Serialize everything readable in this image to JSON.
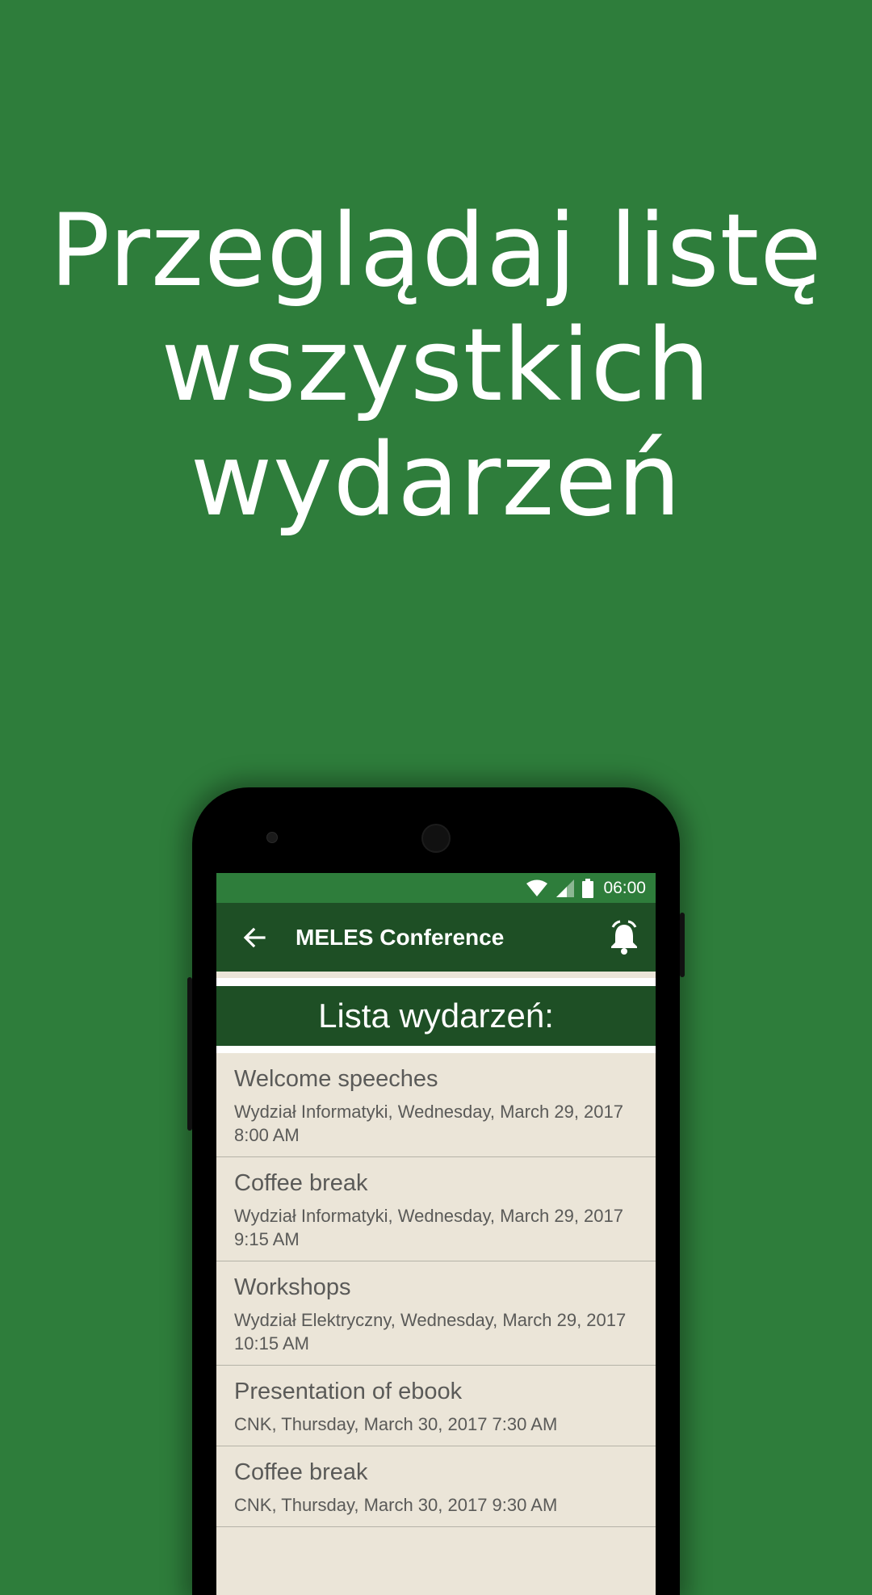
{
  "headline": {
    "line1": "Przeglądaj listę",
    "line2": "wszystkich",
    "line3": "wydarzeń"
  },
  "status_bar": {
    "time": "06:00",
    "icons": [
      "wifi-icon",
      "signal-icon",
      "battery-icon"
    ]
  },
  "app_bar": {
    "title": "MELES Conference",
    "back_icon": "arrow-left-icon",
    "action_icon": "alarm-bell-icon"
  },
  "list": {
    "header": "Lista wydarzeń:",
    "items": [
      {
        "name": "Welcome speeches",
        "meta": "Wydział Informatyki, Wednesday, March 29, 2017 8:00 AM"
      },
      {
        "name": "Coffee break",
        "meta": "Wydział Informatyki, Wednesday, March 29, 2017 9:15 AM"
      },
      {
        "name": "Workshops",
        "meta": "Wydział Elektryczny, Wednesday, March 29, 2017 10:15 AM"
      },
      {
        "name": "Presentation of ebook",
        "meta": "CNK, Thursday, March 30, 2017 7:30 AM"
      },
      {
        "name": "Coffee break",
        "meta": "CNK, Thursday, March 30, 2017 9:30 AM"
      }
    ]
  },
  "colors": {
    "background": "#2e7d3b",
    "appbar": "#1e4f25",
    "list_bg": "#ebe5d8",
    "text_muted": "#5a5a58"
  }
}
